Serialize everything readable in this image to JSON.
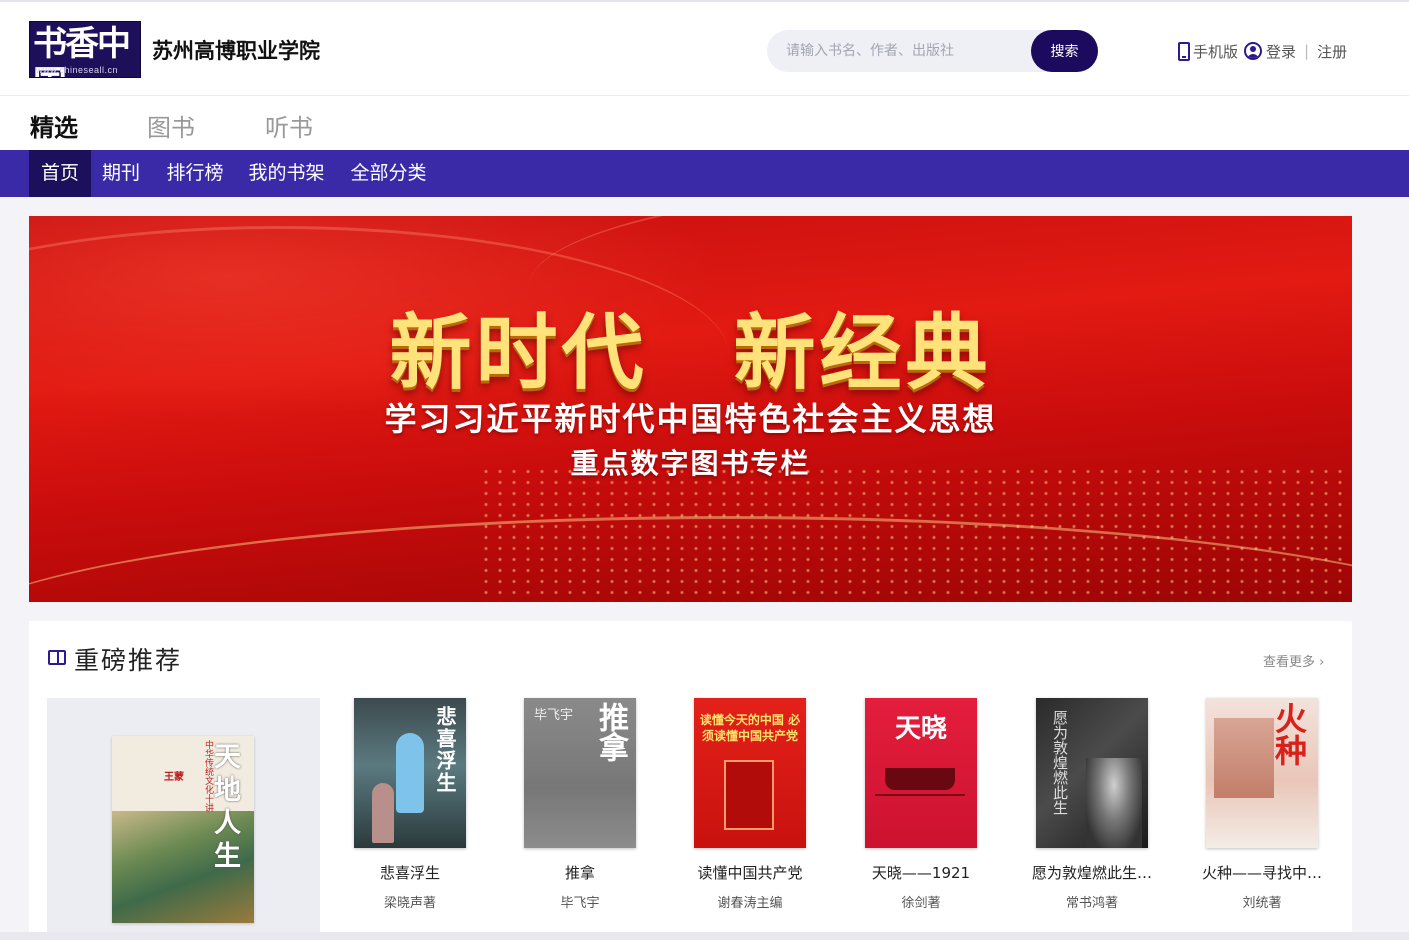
{
  "header": {
    "logo_text": "书香中国",
    "logo_url_text": "www.chineseall.cn",
    "school_name": "苏州高博职业学院",
    "search_placeholder": "请输入书名、作者、出版社",
    "search_button": "搜索",
    "mobile_label": "手机版",
    "login_label": "登录",
    "separator": "|",
    "register_label": "注册"
  },
  "mode_tabs": [
    {
      "label": "精选",
      "active": true
    },
    {
      "label": "图书",
      "active": false
    },
    {
      "label": "听书",
      "active": false
    }
  ],
  "nav": [
    {
      "label": "首页",
      "active": true
    },
    {
      "label": "期刊",
      "active": false
    },
    {
      "label": "排行榜",
      "active": false
    },
    {
      "label": "我的书架",
      "active": false
    },
    {
      "label": "全部分类",
      "active": false
    }
  ],
  "banner": {
    "title": "新时代　新经典",
    "subtitle1": "学习习近平新时代中国特色社会主义思想",
    "subtitle2": "重点数字图书专栏"
  },
  "recommend": {
    "title": "重磅推荐",
    "more_label": "查看更多",
    "more_icon": "chevron-right-icon",
    "feature": {
      "cover_title": "天地人生",
      "cover_series": "中华传统文化十讲",
      "cover_author": "王蒙"
    },
    "books": [
      {
        "title": "悲喜浮生",
        "author": "梁晓声著",
        "cover_text": "悲喜浮生"
      },
      {
        "title": "推拿",
        "author": "毕飞宇",
        "cover_text": "推拿"
      },
      {
        "title": "读懂中国共产党",
        "author": "谢春涛主编",
        "cover_text": "读懂今天的中国 必须读懂中国共产党"
      },
      {
        "title": "天晓——1921",
        "author": "徐剑著",
        "cover_text": "天晓"
      },
      {
        "title": "愿为敦煌燃此生…",
        "author": "常书鸿著",
        "cover_text": "愿为敦煌燃此生"
      },
      {
        "title": "火种——寻找中…",
        "author": "刘统著",
        "cover_text": "火种"
      }
    ]
  },
  "colors": {
    "brand_dark": "#1c0a5e",
    "nav_bg": "#3a2aa8",
    "banner_red": "#d9120f",
    "banner_gold": "#ffe27a"
  }
}
